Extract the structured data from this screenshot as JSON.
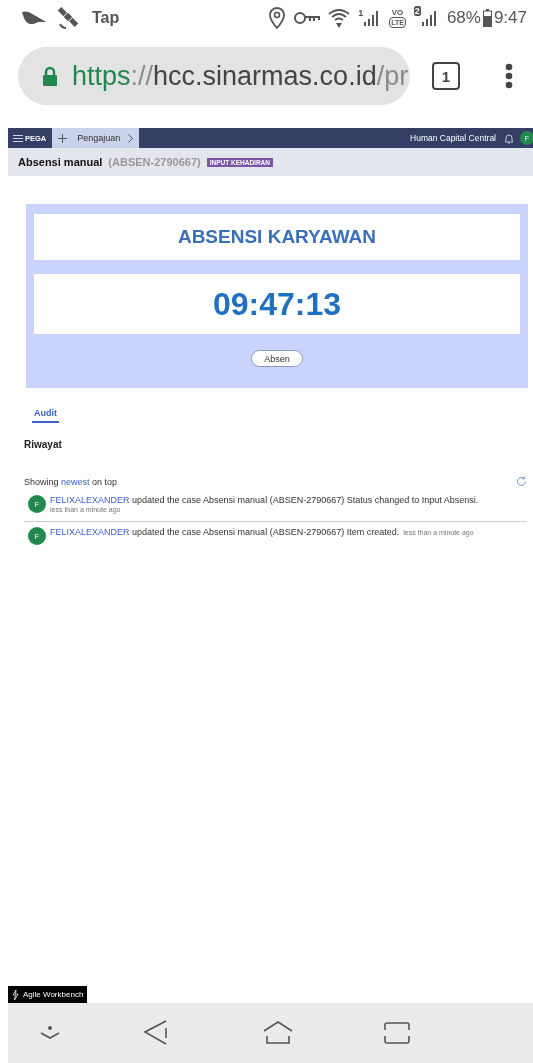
{
  "status_bar": {
    "app_label": "Tap",
    "sim_1": "1",
    "volte_top": "VO",
    "volte_bottom": "LTE",
    "sim_2": "2",
    "battery": "68%",
    "time": "9:47"
  },
  "browser": {
    "url_parts": [
      {
        "kind": "scheme",
        "text": "https"
      },
      {
        "kind": "separator",
        "text": "://"
      },
      {
        "kind": "host",
        "text": "hcc.sinarmas.co.id"
      },
      {
        "kind": "path",
        "text": "/pr"
      }
    ],
    "tab_count": "1"
  },
  "app_nav": {
    "logo": "PEGA",
    "tab": "Pengajuan",
    "title": "Human Capital Central",
    "avatar": "F"
  },
  "case_header": {
    "title": "Absensi manual",
    "case_id": "(ABSEN-2790667)",
    "status": "INPUT KEHADIRAN"
  },
  "attendance": {
    "heading": "ABSENSI KARYAWAN",
    "clock": "09:47:13",
    "button": "Absen"
  },
  "audit": {
    "tabs": [
      {
        "label": "Audit",
        "selected": true
      }
    ],
    "section": "Riwayat",
    "sort_prefix": "Showing",
    "sort_link": "newest",
    "sort_suffix": "on top",
    "entries": [
      {
        "kind": "below",
        "avatar": "F",
        "user": "FELIXALEXANDER",
        "text": "updated the case Absensi manual (ABSEN-2790667)  Status changed to Input Absensi.",
        "time": "less than a minute ago"
      },
      {
        "kind": "inline",
        "avatar": "F",
        "user": "FELIXALEXANDER",
        "text": "updated the case Absensi manual (ABSEN-2790667)  Item created.",
        "time": "less than a minute ago"
      }
    ]
  },
  "workbench": {
    "label": "Agile Workbench"
  }
}
